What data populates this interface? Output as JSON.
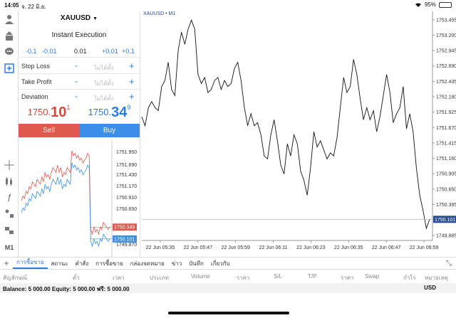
{
  "status": {
    "time": "14:05",
    "date": "จ. 22 มิ.ย.",
    "battery": "95%"
  },
  "panel": {
    "symbol": "XAUUSD",
    "mode": "Instant Execution",
    "adjustments": [
      "-0.1",
      "-0.01",
      "0.01",
      "+0.01",
      "+0.1"
    ],
    "rows": [
      {
        "label": "Stop Loss",
        "placeholder": "ไม่ได้ตั้ง"
      },
      {
        "label": "Take Profit",
        "placeholder": "ไม่ได้ตั้ง"
      },
      {
        "label": "Deviation",
        "placeholder": "ไม่ได้ตั้ง"
      }
    ],
    "bid": {
      "small": "1750.",
      "big": "10",
      "sup": "1"
    },
    "ask": {
      "small": "1750.",
      "big": "34",
      "sup": "9"
    },
    "sell_label": "Sell",
    "buy_label": "Buy"
  },
  "mini_chart": {
    "yticks": [
      "1751.950",
      "1751.690",
      "1751.430",
      "1751.170",
      "1750.910",
      "1750.650",
      "1750.349",
      "1750.101",
      "1749.870"
    ],
    "ask_label": "1750.349",
    "bid_label": "1750.101",
    "colors": {
      "ask": "#de5a4c",
      "bid": "#3c8ee8"
    }
  },
  "chart_data": {
    "type": "line",
    "title": "XAUUSD • M1",
    "xlabel": "",
    "ylabel": "",
    "ylim": [
      1749.8,
      1753.5
    ],
    "x_ticks": [
      "22 Jun 05:35",
      "22 Jun 05:47",
      "22 Jun 05:59",
      "22 Jun 06:11",
      "22 Jun 06:23",
      "22 Jun 06:35",
      "22 Jun 06:47",
      "22 Jun 06:59"
    ],
    "y_ticks": [
      "1753.455",
      "1753.200",
      "1752.945",
      "1752.690",
      "1752.435",
      "1752.180",
      "1751.925",
      "1751.670",
      "1751.415",
      "1751.160",
      "1750.905",
      "1750.650",
      "1750.395",
      "1749.885"
    ],
    "last_price_label": "1750.101",
    "values": [
      1751.85,
      1751.7,
      1752.0,
      1752.1,
      1752.0,
      1751.95,
      1752.35,
      1752.45,
      1752.75,
      1752.3,
      1752.2,
      1752.95,
      1753.25,
      1753.05,
      1753.3,
      1753.45,
      1753.3,
      1752.55,
      1752.4,
      1752.5,
      1752.25,
      1752.3,
      1752.45,
      1752.5,
      1752.3,
      1752.45,
      1752.35,
      1752.4,
      1752.65,
      1752.75,
      1752.45,
      1752.0,
      1751.7,
      1751.9,
      1751.7,
      1751.75,
      1751.55,
      1751.2,
      1751.15,
      1751.55,
      1751.8,
      1751.45,
      1751.05,
      1750.9,
      1751.4,
      1751.2,
      1751.55,
      1751.4,
      1750.95,
      1750.8,
      1750.55,
      1751.0,
      1751.6,
      1751.35,
      1751.45,
      1751.3,
      1751.15,
      1751.25,
      1751.2,
      1751.5,
      1752.0,
      1752.5,
      1752.25,
      1752.35,
      1752.8,
      1752.55,
      1752.15,
      1751.8,
      1752.0,
      1751.8,
      1751.95,
      1751.6,
      1751.85,
      1752.2,
      1752.55,
      1752.25,
      1751.75,
      1751.9,
      1752.0,
      1752.35,
      1751.65,
      1751.9,
      1751.6,
      1751.0,
      1750.55,
      1750.3,
      1750.0,
      1750.15
    ],
    "grid": false,
    "line_color": "#111111"
  },
  "tabs": {
    "items": [
      "การซื้อขาย",
      "สถานะ",
      "คำสั่ง",
      "การซื้อขาย",
      "กล่องจดหมาย",
      "ข่าว",
      "บันทึก",
      "เกี่ยวกับ"
    ]
  },
  "columns": [
    "สัญลักษณ์",
    "ตั๋ว",
    "เวลา",
    "ประเภท",
    "Volume",
    "ราคา",
    "S/L",
    "T/P",
    "ราคา",
    "Swap",
    "กำไร",
    "หมายเหตุ"
  ],
  "balance": {
    "text": "Balance: 5 000.00 Equity: 5 000.00 ฟรี: 5 000.00",
    "currency": "USD"
  }
}
